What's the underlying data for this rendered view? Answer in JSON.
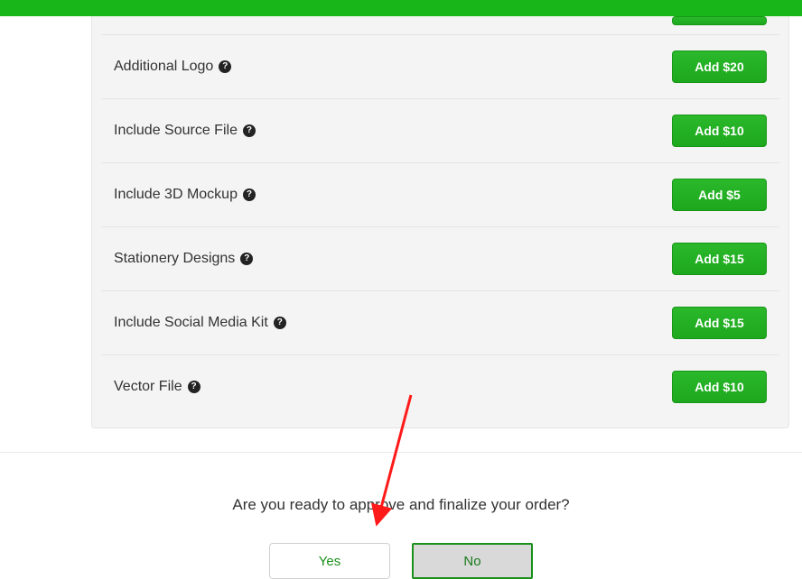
{
  "addons": [
    {
      "label": "Additional Logo",
      "price": "Add $20"
    },
    {
      "label": "Include Source File",
      "price": "Add $10"
    },
    {
      "label": "Include 3D Mockup",
      "price": "Add $5"
    },
    {
      "label": "Stationery Designs",
      "price": "Add $15"
    },
    {
      "label": "Include Social Media Kit",
      "price": "Add $15"
    },
    {
      "label": "Vector File",
      "price": "Add $10"
    }
  ],
  "finalize": {
    "question": "Are you ready to approve and finalize your order?",
    "yes": "Yes",
    "no": "No"
  },
  "help_glyph": "?"
}
